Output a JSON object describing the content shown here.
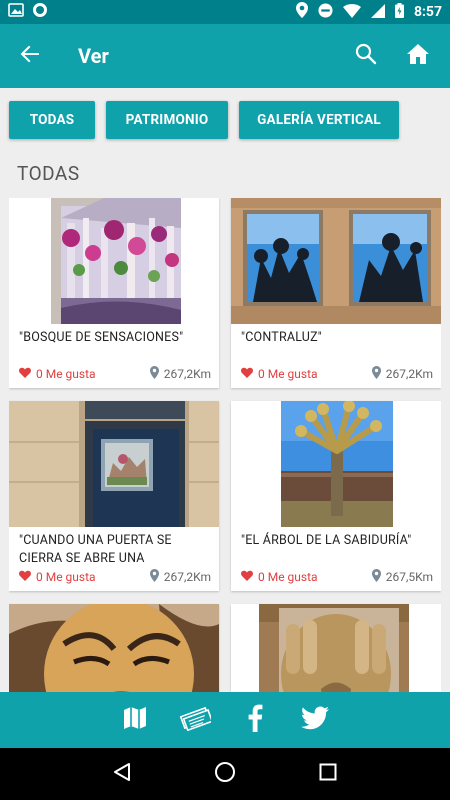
{
  "status_bar": {
    "time": "8:57",
    "icons": [
      "photo-icon",
      "circle-icon",
      "location-icon",
      "dnd-icon",
      "wifi-icon",
      "signal-icon",
      "battery-icon"
    ]
  },
  "app_bar": {
    "title": "Ver",
    "icons": [
      "back-arrow-icon",
      "search-icon",
      "home-icon"
    ]
  },
  "filters": [
    {
      "label": "TODAS"
    },
    {
      "label": "PATRIMONIO"
    },
    {
      "label": "GALERÍA VERTICAL"
    }
  ],
  "section_title": "TODAS",
  "cards": [
    {
      "title": "\"BOSQUE DE SENSACIONES\"",
      "likes": "0 Me gusta",
      "distance": "267,2Km"
    },
    {
      "title": "\"CONTRALUZ\"",
      "likes": "0 Me gusta",
      "distance": "267,2Km"
    },
    {
      "title": "\"CUANDO UNA PUERTA SE CIERRA SE ABRE UNA",
      "likes": "0 Me gusta",
      "distance": "267,2Km"
    },
    {
      "title": "\"EL ÁRBOL DE LA SABIDURÍA\"",
      "likes": "0 Me gusta",
      "distance": "267,5Km"
    },
    {
      "title": "",
      "likes": "",
      "distance": ""
    },
    {
      "title": "",
      "likes": "",
      "distance": ""
    }
  ],
  "bottom_bar": {
    "icons": [
      "map-icon",
      "ticket-icon",
      "facebook-icon",
      "twitter-icon"
    ]
  },
  "nav_bar": {
    "icons": [
      "back-triangle-icon",
      "home-circle-icon",
      "recents-square-icon"
    ]
  },
  "colors": {
    "primary": "#0fa2ab",
    "primary_dark": "#00808a",
    "like_red": "#e04040"
  }
}
